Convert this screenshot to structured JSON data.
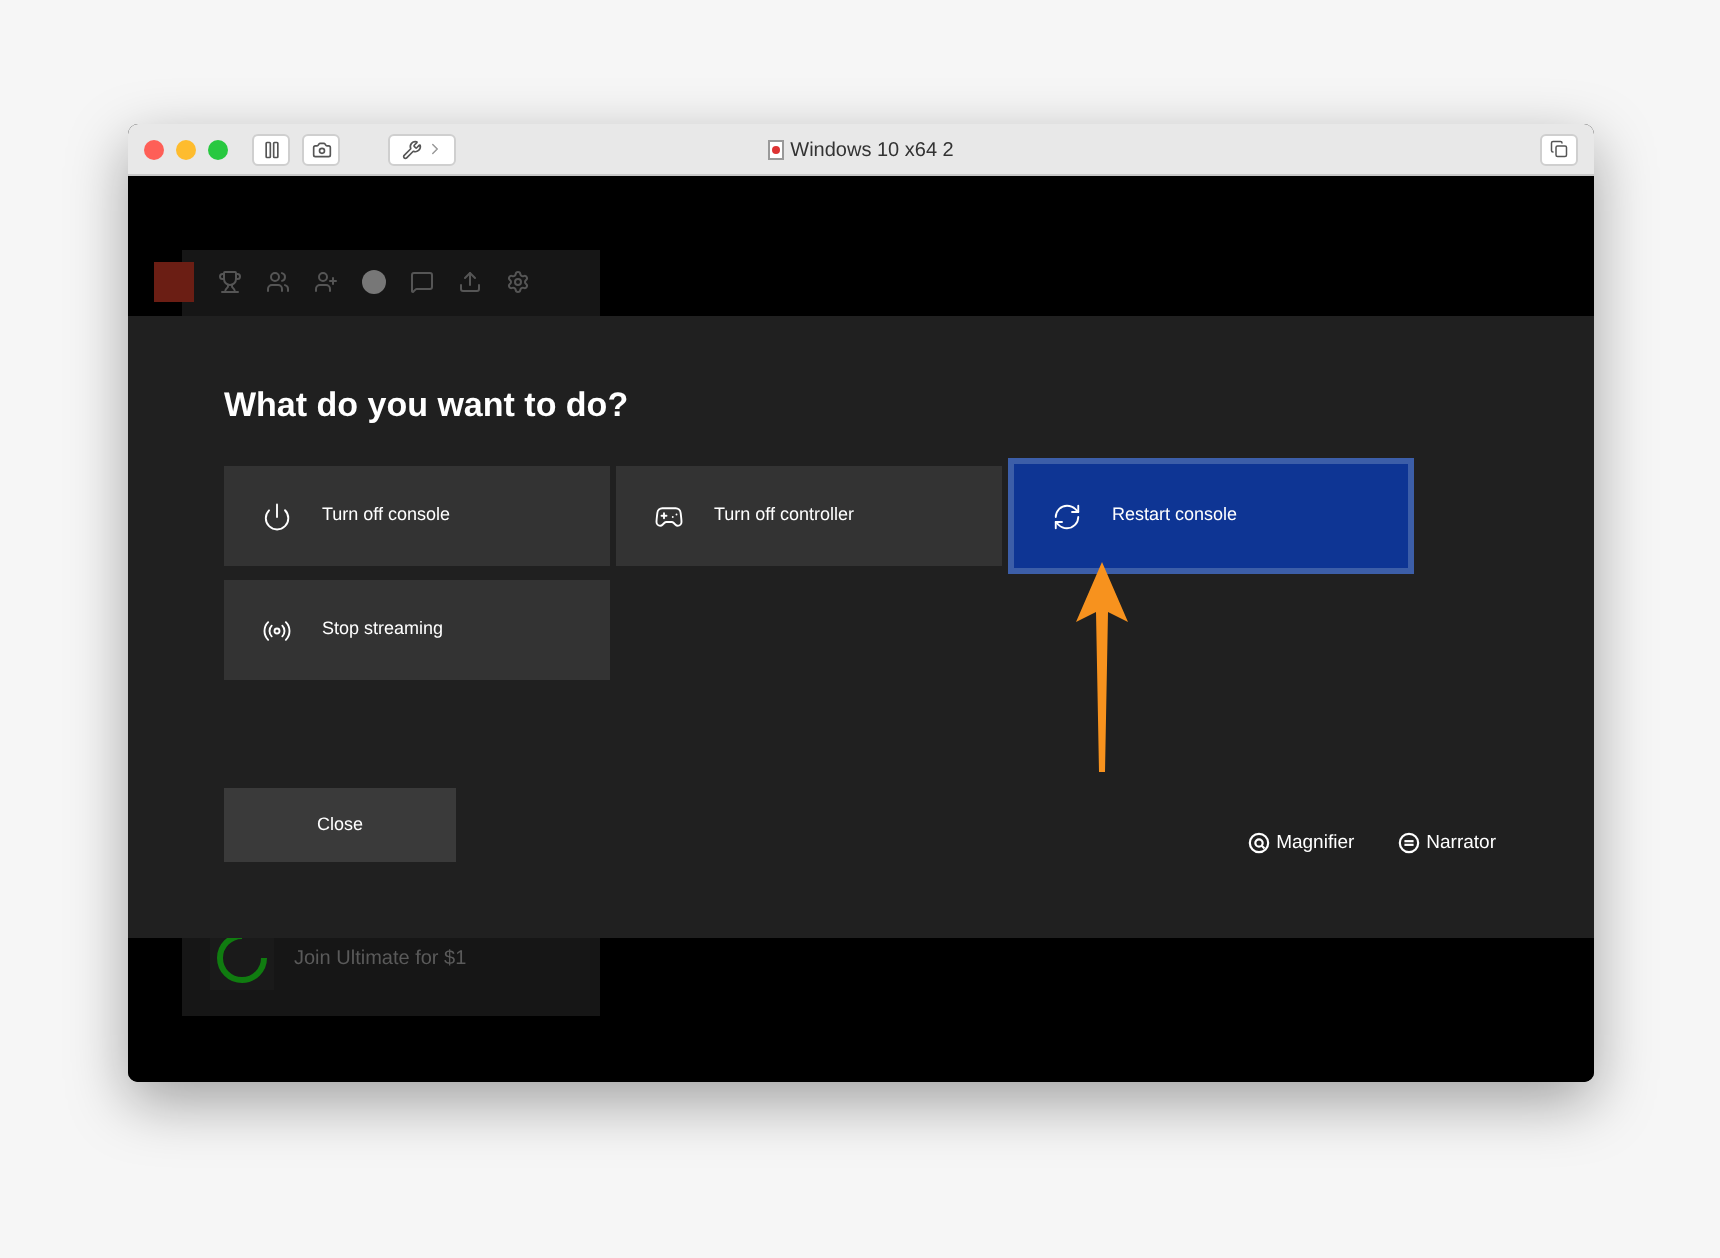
{
  "window": {
    "title": "Windows 10 x64 2"
  },
  "background": {
    "promo": "Join Ultimate for $1"
  },
  "dialog": {
    "title": "What do you want to do?",
    "options": [
      {
        "label": "Turn off console",
        "kind": "power",
        "selected": false
      },
      {
        "label": "Turn off controller",
        "kind": "controller",
        "selected": false
      },
      {
        "label": "Restart console",
        "kind": "restart",
        "selected": true
      },
      {
        "label": "Stop streaming",
        "kind": "streaming",
        "selected": false
      }
    ],
    "close_button": "Close",
    "accessibility": [
      {
        "label": "Magnifier",
        "kind": "magnifier"
      },
      {
        "label": "Narrator",
        "kind": "narrator"
      }
    ]
  }
}
